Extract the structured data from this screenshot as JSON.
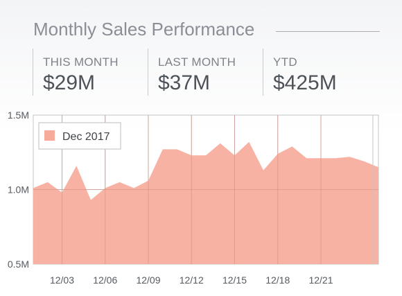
{
  "header": {
    "title": "Monthly Sales Performance"
  },
  "kpis": [
    {
      "label": "THIS MONTH",
      "value": "$29M"
    },
    {
      "label": "LAST MONTH",
      "value": "$37M"
    },
    {
      "label": "YTD",
      "value": "$425M"
    }
  ],
  "colors": {
    "area_fill": "#f6ab9b",
    "grid": "#c3c5c8",
    "axis_text": "#555a60"
  },
  "chart_data": {
    "type": "area",
    "title": "",
    "xlabel": "",
    "ylabel": "",
    "ylim": [
      0.5,
      1.5
    ],
    "y_ticks": [
      "0.5M",
      "1.0M",
      "1.5M"
    ],
    "x": [
      "12/01",
      "12/02",
      "12/03",
      "12/04",
      "12/05",
      "12/06",
      "12/07",
      "12/08",
      "12/09",
      "12/10",
      "12/11",
      "12/12",
      "12/13",
      "12/14",
      "12/15",
      "12/16",
      "12/17",
      "12/18",
      "12/19",
      "12/20",
      "12/21",
      "12/22",
      "12/23",
      "12/24",
      "12/25"
    ],
    "x_ticks": [
      "12/03",
      "12/06",
      "12/09",
      "12/12",
      "12/15",
      "12/18",
      "12/21"
    ],
    "grid": true,
    "legend_position": "top-left",
    "series": [
      {
        "name": "Dec 2017",
        "values": [
          1.01,
          1.05,
          0.98,
          1.16,
          0.93,
          1.01,
          1.05,
          1.01,
          1.06,
          1.27,
          1.27,
          1.23,
          1.23,
          1.31,
          1.23,
          1.32,
          1.13,
          1.24,
          1.29,
          1.21,
          1.21,
          1.21,
          1.22,
          1.19,
          1.15
        ]
      }
    ]
  }
}
